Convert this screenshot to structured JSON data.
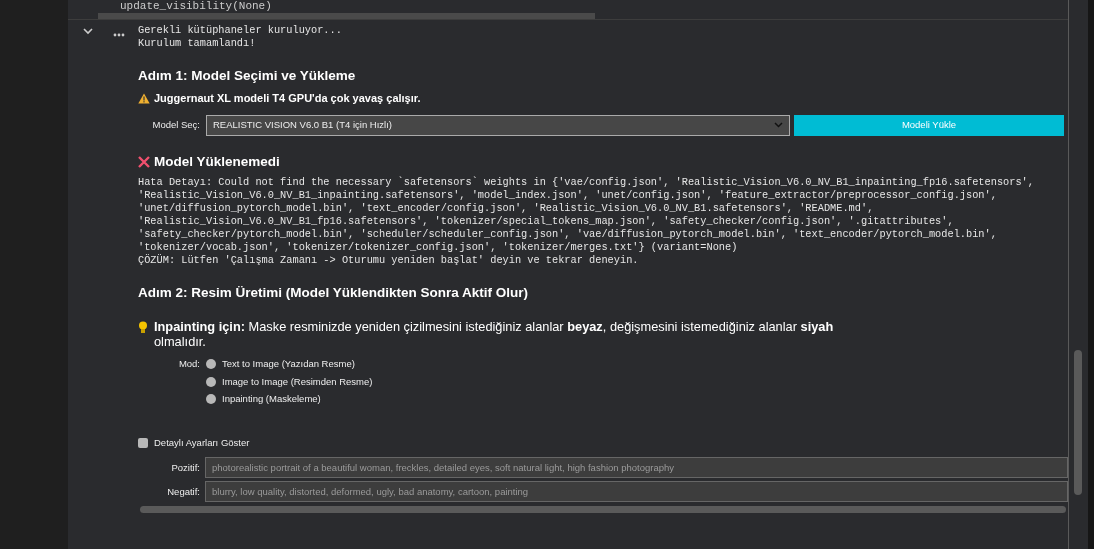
{
  "code_tail": "update_visibility(None)",
  "output_lines": [
    "Gerekli kütüphaneler kuruluyor...",
    "Kurulum tamamlandı!"
  ],
  "step1": {
    "title": "Adım 1: Model Seçimi ve Yükleme",
    "warning": "Juggernaut XL modeli T4 GPU'da çok yavaş çalışır.",
    "model_select": {
      "label": "Model Seç:",
      "value": "REALISTIC VISION V6.0 B1 (T4 için Hızlı)"
    },
    "load_button": "Modeli Yükle"
  },
  "error": {
    "title": "Model Yüklenemedi",
    "detail_lines": [
      "Hata Detayı: Could not find the necessary `safetensors` weights in {'vae/config.json', 'Realistic_Vision_V6.0_NV_B1_inpainting_fp16.safetensors',",
      "'Realistic_Vision_V6.0_NV_B1_inpainting.safetensors', 'model_index.json', 'unet/config.json', 'feature_extractor/preprocessor_config.json',",
      "'unet/diffusion_pytorch_model.bin', 'text_encoder/config.json', 'Realistic_Vision_V6.0_NV_B1.safetensors', 'README.md',",
      "'Realistic_Vision_V6.0_NV_B1_fp16.safetensors', 'tokenizer/special_tokens_map.json', 'safety_checker/config.json', '.gitattributes',",
      "'safety_checker/pytorch_model.bin', 'scheduler/scheduler_config.json', 'vae/diffusion_pytorch_model.bin', 'text_encoder/pytorch_model.bin',",
      "'tokenizer/vocab.json', 'tokenizer/tokenizer_config.json', 'tokenizer/merges.txt'} (variant=None)",
      "ÇÖZÜM: Lütfen 'Çalışma Zamanı -> Oturumu yeniden başlat' deyin ve tekrar deneyin."
    ]
  },
  "step2": {
    "title": "Adım 2: Resim Üretimi (Model Yüklendikten Sonra Aktif Olur)",
    "tip": "**Inpainting için:** Maske resminizde yeniden çizilmesini istediğiniz alanlar **beyaz**, değişmesini istemediğiniz alanlar **siyah** olmalıdır.",
    "mode": {
      "label": "Mod:",
      "options": [
        {
          "label": "Text to Image (Yazıdan Resme)",
          "selected": false
        },
        {
          "label": "Image to Image (Resimden Resme)",
          "selected": false
        },
        {
          "label": "Inpainting (Maskeleme)",
          "selected": false
        }
      ]
    }
  },
  "advanced": {
    "label": "Detaylı Ayarları Göster",
    "checked": false
  },
  "prompts": [
    {
      "label": "Pozitif:",
      "placeholder": "photorealistic portrait of a beautiful woman, freckles, detailed eyes, soft natural light, high fashion photography"
    },
    {
      "label": "Negatif:",
      "placeholder": "blurry, low quality, distorted, deformed, ugly, bad anatomy, cartoon, painting"
    }
  ]
}
